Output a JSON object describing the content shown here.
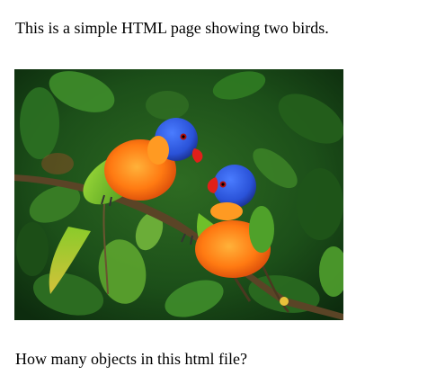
{
  "page": {
    "intro_text": "This is a simple HTML page showing two birds.",
    "question_text": "How many objects in this html file?"
  },
  "image": {
    "subject": "two rainbow lorikeets perched on a branch among green leaves",
    "colors": {
      "leaf_dark": "#123d12",
      "leaf_mid": "#2f7a22",
      "leaf_light": "#6fb23a",
      "bird_blue": "#2a52d8",
      "bird_orange": "#ff7a12",
      "bird_green": "#6fc02a",
      "beak_red": "#e0201a",
      "branch": "#5a4426"
    }
  }
}
